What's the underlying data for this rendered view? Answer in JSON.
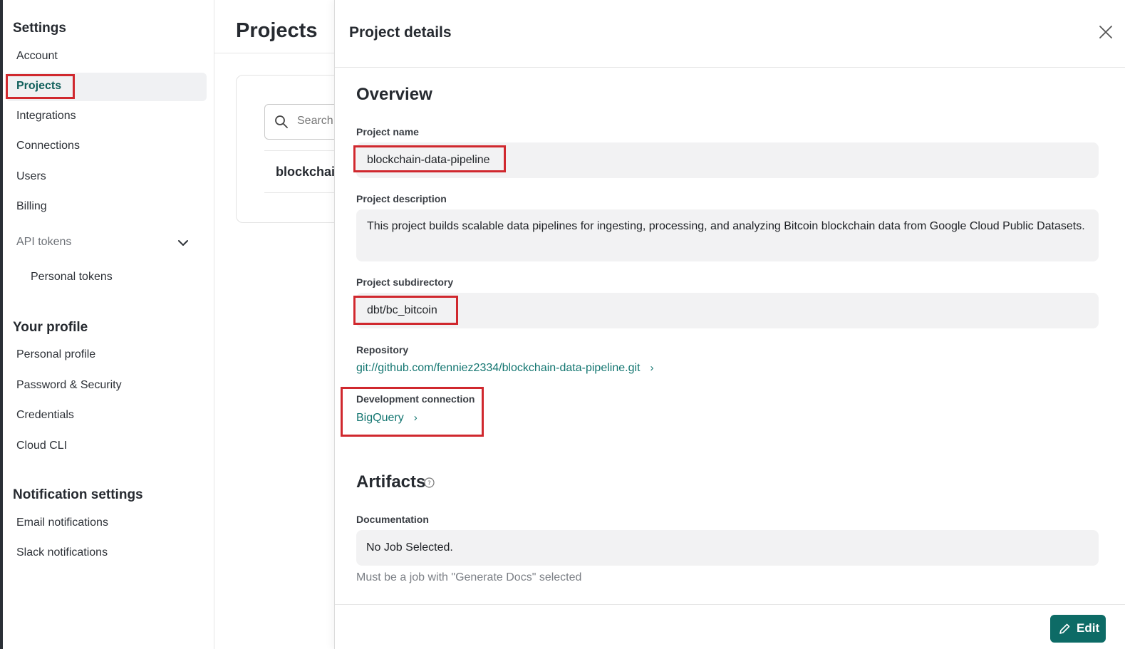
{
  "sidebar": {
    "settings_title": "Settings",
    "settings_items": [
      "Account",
      "Projects",
      "Integrations",
      "Connections",
      "Users",
      "Billing"
    ],
    "api_tokens_label": "API tokens",
    "personal_tokens_label": "Personal tokens",
    "profile_title": "Your profile",
    "profile_items": [
      "Personal profile",
      "Password & Security",
      "Credentials",
      "Cloud CLI"
    ],
    "notifications_title": "Notification settings",
    "notification_items": [
      "Email notifications",
      "Slack notifications"
    ]
  },
  "projects": {
    "title": "Projects",
    "search_placeholder": "Search",
    "row_name": "blockchai"
  },
  "details": {
    "title": "Project details",
    "overview_title": "Overview",
    "project_name_label": "Project name",
    "project_name": "blockchain-data-pipeline",
    "project_description_label": "Project description",
    "project_description": "This project builds scalable data pipelines for ingesting, processing, and analyzing Bitcoin blockchain data from Google Cloud Public Datasets.",
    "subdirectory_label": "Project subdirectory",
    "subdirectory": "dbt/bc_bitcoin",
    "repository_label": "Repository",
    "repository": "git://github.com/fenniez2334/blockchain-data-pipeline.git",
    "dev_connection_label": "Development connection",
    "dev_connection": "BigQuery",
    "artifacts_title": "Artifacts",
    "documentation_label": "Documentation",
    "documentation_value": "No Job Selected.",
    "documentation_hint": "Must be a job with \"Generate Docs\" selected",
    "edit_label": "Edit"
  },
  "colors": {
    "accent": "#0d6b66",
    "link": "#127570",
    "highlight_box": "#d0282e"
  }
}
